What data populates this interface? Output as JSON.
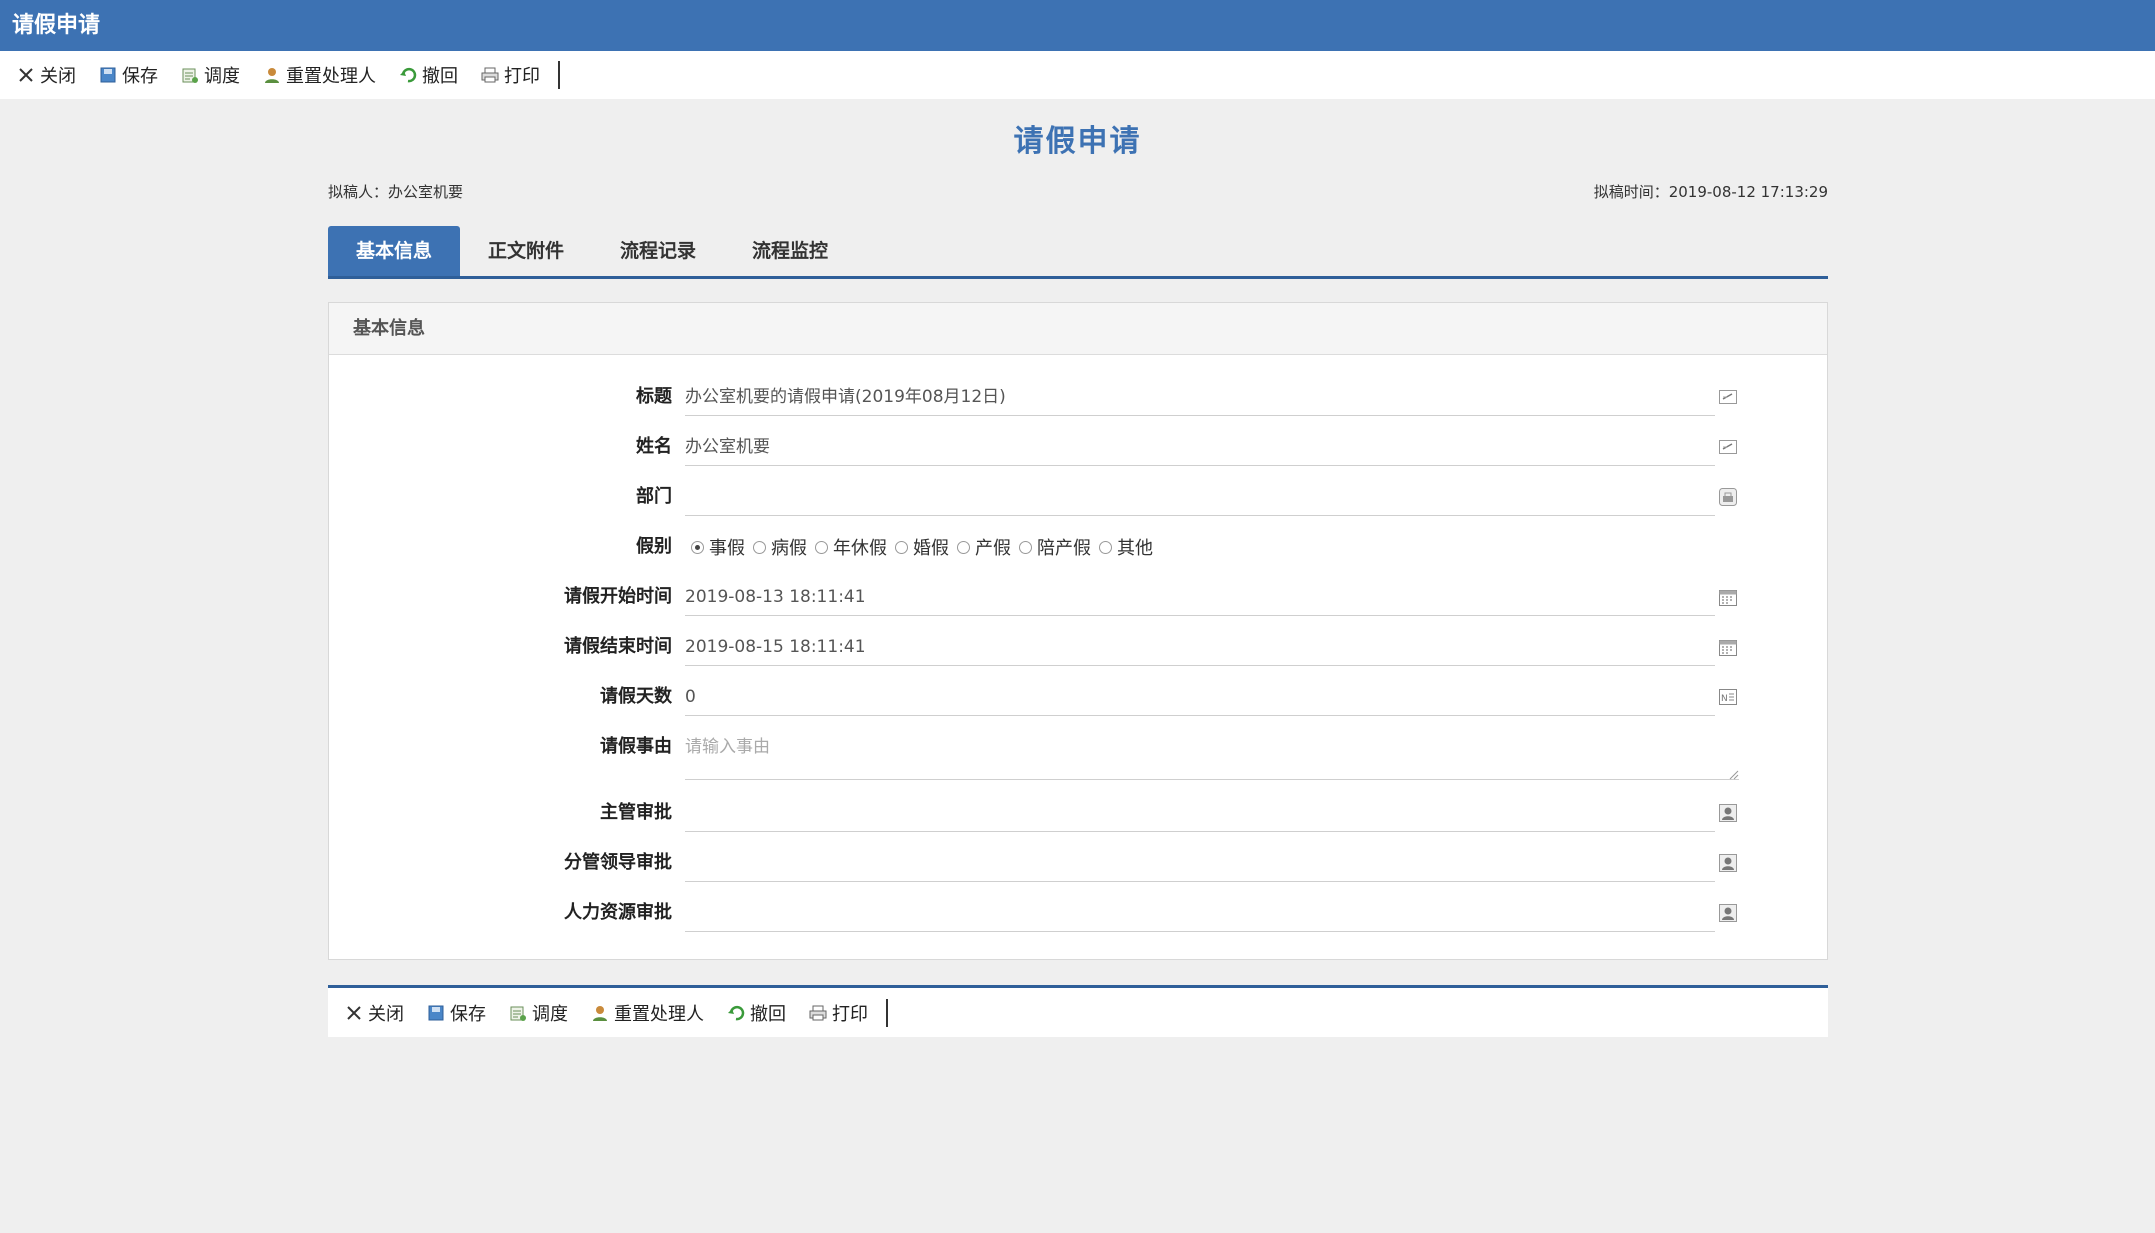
{
  "window": {
    "title": "请假申请"
  },
  "toolbar": {
    "buttons": [
      {
        "label": "关闭",
        "icon": "close-icon"
      },
      {
        "label": "保存",
        "icon": "save-icon"
      },
      {
        "label": "调度",
        "icon": "dispatch-icon"
      },
      {
        "label": "重置处理人",
        "icon": "reset-handler-icon"
      },
      {
        "label": "撤回",
        "icon": "undo-icon"
      },
      {
        "label": "打印",
        "icon": "print-icon"
      }
    ]
  },
  "page": {
    "title": "请假申请",
    "drafter": "拟稿人：办公室机要",
    "draft_time": "拟稿时间：2019-08-12 17:13:29"
  },
  "tabs": [
    "基本信息",
    "正文附件",
    "流程记录",
    "流程监控"
  ],
  "panel": {
    "title": "基本信息",
    "fields": {
      "title": {
        "label": "标题",
        "value": "办公室机要的请假申请(2019年08月12日)"
      },
      "name": {
        "label": "姓名",
        "value": "办公室机要"
      },
      "dept": {
        "label": "部门",
        "value": ""
      },
      "leave_type": {
        "label": "假别",
        "options": [
          "事假",
          "病假",
          "年休假",
          "婚假",
          "产假",
          "陪产假",
          "其他"
        ],
        "selected": "事假"
      },
      "start": {
        "label": "请假开始时间",
        "value": "2019-08-13 18:11:41"
      },
      "end": {
        "label": "请假结束时间",
        "value": "2019-08-15 18:11:41"
      },
      "days": {
        "label": "请假天数",
        "value": "0"
      },
      "reason": {
        "label": "请假事由",
        "placeholder": "请输入事由"
      },
      "supervisor": {
        "label": "主管审批",
        "value": ""
      },
      "leader": {
        "label": "分管领导审批",
        "value": ""
      },
      "hr": {
        "label": "人力资源审批",
        "value": ""
      }
    }
  },
  "colors": {
    "accent": "#3d72b3",
    "accent_dark": "#2f5f99",
    "background": "#efefef"
  }
}
